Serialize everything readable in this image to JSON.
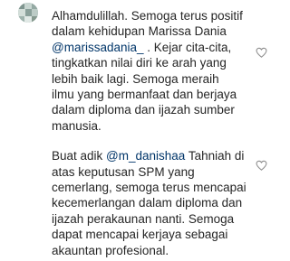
{
  "comment": {
    "paragraph1": {
      "line1": "Alhamdulillah. Semoga terus positif",
      "line2": "dalam kehidupan Marissa Dania",
      "line3_mention": "@marissadania_",
      "line3_rest": " . Kejar cita-cita,",
      "line4": "tingkatkan nilai diri ke arah yang",
      "line5": "lebih baik lagi. Semoga meraih",
      "line6": "ilmu yang bermanfaat dan berjaya",
      "line7": "dalam diploma dan ijazah sumber",
      "line8": "manusia."
    },
    "paragraph2": {
      "line1_prefix": "Buat adik ",
      "line1_mention": "@m_danishaa",
      "line1_rest": " Tahniah di",
      "line2": "atas keputusan SPM yang",
      "line3": "cemerlang, semoga terus mencapai",
      "line4": "kecemerlangan dalam diploma dan",
      "line5": "ijazah perakaunan nanti. Semoga",
      "line6": "dapat mencapai kerjaya sebagai",
      "line7": "akauntan profesional."
    }
  },
  "icons": {
    "like": "heart-outline-icon"
  },
  "colors": {
    "text": "#262626",
    "mention": "#003569",
    "icon": "#8e8e8e"
  }
}
